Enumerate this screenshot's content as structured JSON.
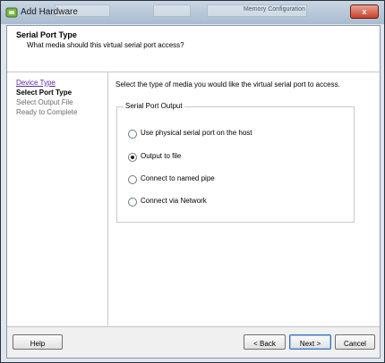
{
  "window": {
    "title": "Add Hardware",
    "close_glyph": "x",
    "background_ghost_text": "Memory Configuration"
  },
  "header": {
    "title": "Serial Port Type",
    "subtitle": "What media should this virtual serial port access?"
  },
  "steps": [
    {
      "label": "Device Type",
      "state": "link"
    },
    {
      "label": "Select Port Type",
      "state": "current"
    },
    {
      "label": "Select Output File",
      "state": "pending"
    },
    {
      "label": "Ready to Complete",
      "state": "pending"
    }
  ],
  "content": {
    "instruction": "Select the type of media you would like the virtual serial port to access.",
    "group_label": "Serial Port Output",
    "options": [
      {
        "label": "Use physical serial port on the host",
        "checked": false
      },
      {
        "label": "Output to file",
        "checked": true
      },
      {
        "label": "Connect to named pipe",
        "checked": false
      },
      {
        "label": "Connect via Network",
        "checked": false
      }
    ]
  },
  "buttons": {
    "help": "Help",
    "back": "< Back",
    "next": "Next >",
    "cancel": "Cancel"
  },
  "colors": {
    "link": "#5c2aa3",
    "close": "#c8402b"
  }
}
